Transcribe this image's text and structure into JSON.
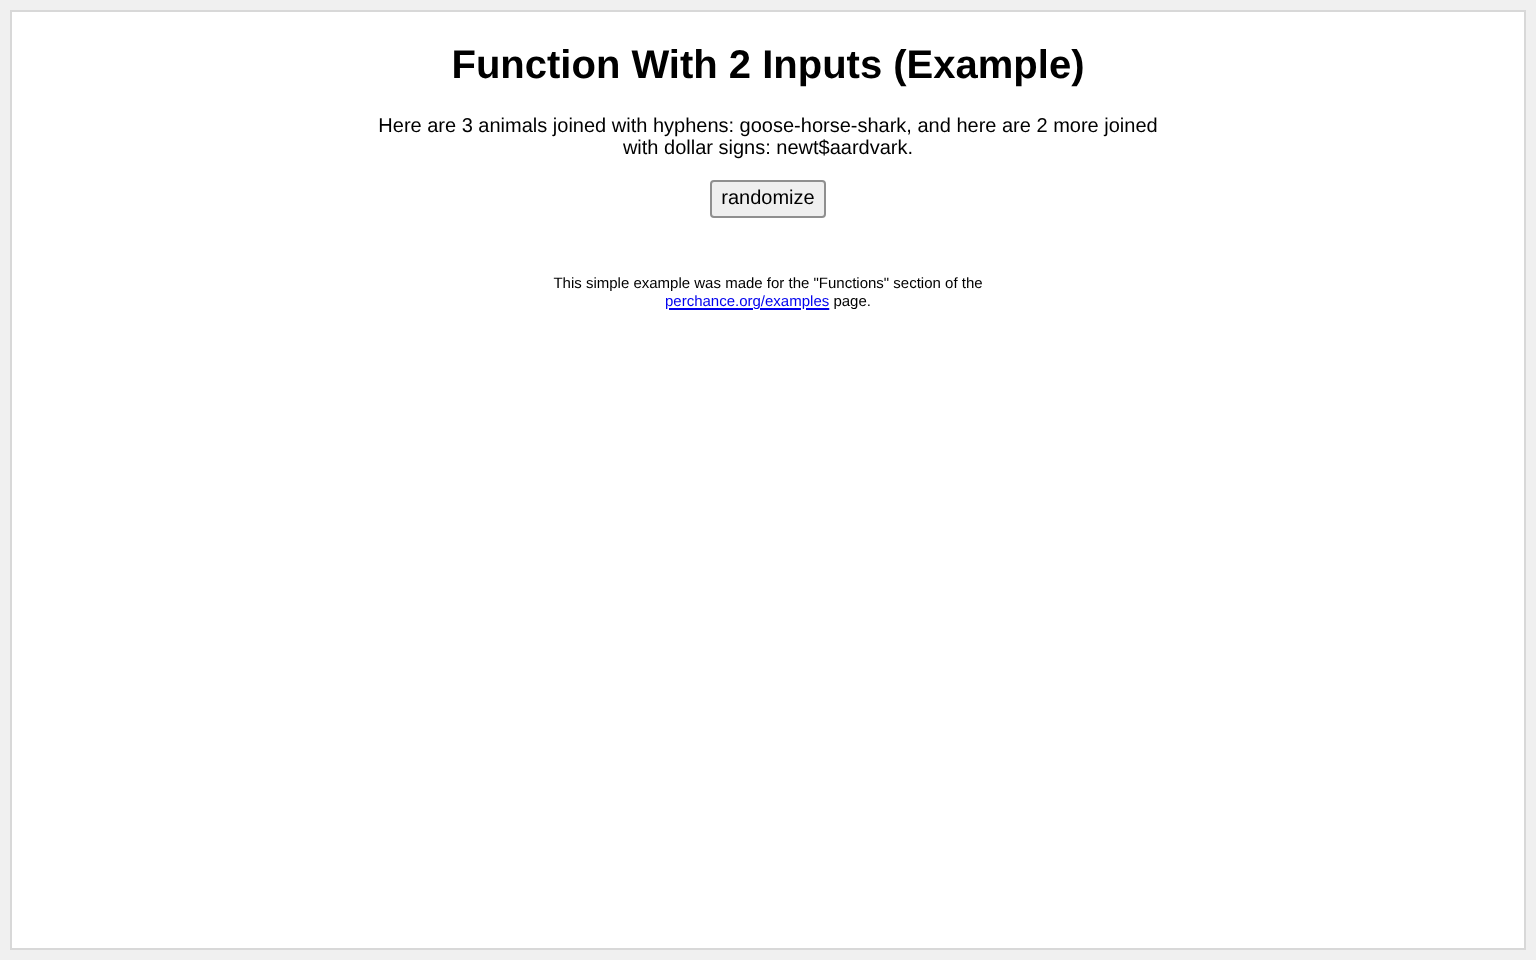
{
  "title": "Function With 2 Inputs (Example)",
  "output": "Here are 3 animals joined with hyphens: goose-horse-shark, and here are 2 more joined with dollar signs: newt$aardvark.",
  "button": "randomize",
  "footnote": {
    "before": "This simple example was made for the \"Functions\" section of the",
    "link": "perchance.org/examples",
    "after": "page."
  }
}
